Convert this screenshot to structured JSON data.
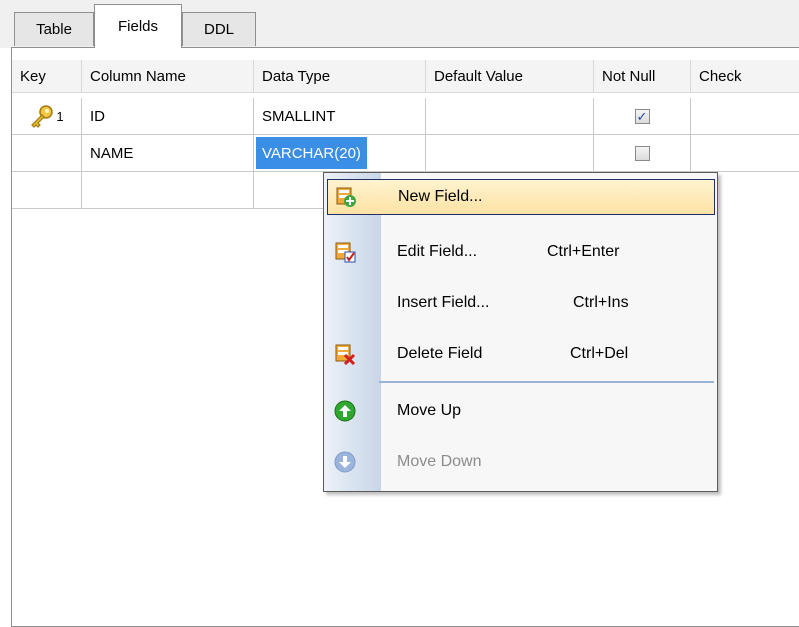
{
  "tabs": [
    {
      "label": "Table",
      "active": false
    },
    {
      "label": "Fields",
      "active": true
    },
    {
      "label": "DDL",
      "active": false
    }
  ],
  "grid": {
    "columns": [
      "Key",
      "Column Name",
      "Data Type",
      "Default Value",
      "Not Null",
      "Check"
    ],
    "rows": [
      {
        "key_icon": "primary-key-icon",
        "key_index": "1",
        "column_name": "ID",
        "data_type": "SMALLINT",
        "default_value": "",
        "not_null": true,
        "check": ""
      },
      {
        "key_icon": "",
        "key_index": "",
        "column_name": "NAME",
        "data_type": "VARCHAR(20)",
        "default_value": "",
        "not_null": false,
        "check": ""
      }
    ]
  },
  "context_menu": {
    "items": [
      {
        "icon": "new-field-icon",
        "label": "New Field...",
        "shortcut": "",
        "highlighted": true,
        "enabled": true
      },
      {
        "icon": "edit-field-icon",
        "label": "Edit Field...",
        "shortcut": "Ctrl+Enter",
        "highlighted": false,
        "enabled": true
      },
      {
        "icon": "",
        "label": "Insert Field...",
        "shortcut": "Ctrl+Ins",
        "highlighted": false,
        "enabled": true
      },
      {
        "icon": "delete-field-icon",
        "label": "Delete Field",
        "shortcut": "Ctrl+Del",
        "highlighted": false,
        "enabled": true
      },
      {
        "icon": "move-up-icon",
        "label": "Move Up",
        "shortcut": "",
        "highlighted": false,
        "enabled": true
      },
      {
        "icon": "move-down-icon",
        "label": "Move Down",
        "shortcut": "",
        "highlighted": false,
        "enabled": false
      }
    ]
  },
  "colors": {
    "selection": "#3a8ee6",
    "menu_highlight": "#fde2a4",
    "move_up": "#2fa82f",
    "move_down_disabled": "#9ab4dc"
  }
}
